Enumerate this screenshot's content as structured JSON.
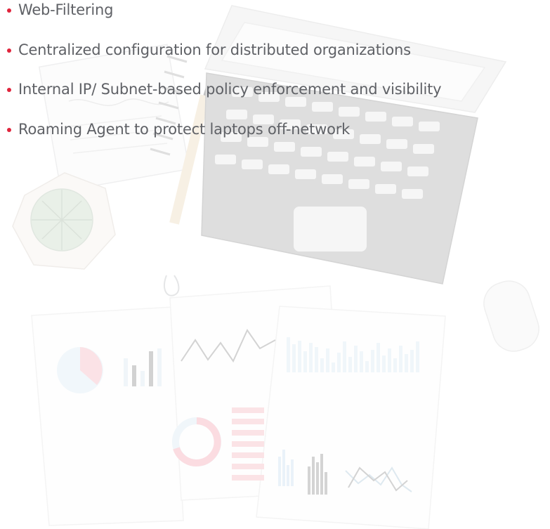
{
  "features": {
    "items": [
      {
        "label": "Web-Filtering"
      },
      {
        "label": "Centralized configuration for distributed organizations"
      },
      {
        "label": "Internal IP/ Subnet-based policy enforcement and visibility"
      },
      {
        "label": "Roaming Agent to protect laptops off-network"
      }
    ],
    "bullet_icon": "bullet-dot-icon"
  },
  "colors": {
    "text": "#5f6166",
    "bullet": "#e0243c",
    "illustration_gray": "#d7d8da",
    "illustration_red": "#f2b7be",
    "illustration_blue": "#d6e7f1",
    "illustration_green": "#c9dcc5"
  },
  "illustration": {
    "icons": [
      "notebook-icon",
      "pencil-icon",
      "laptop-icon",
      "succulent-plant-icon",
      "mouse-icon",
      "paperclip-icon",
      "report-paper-icon",
      "pie-chart-icon",
      "bar-chart-icon",
      "line-chart-icon",
      "donut-chart-icon"
    ]
  }
}
